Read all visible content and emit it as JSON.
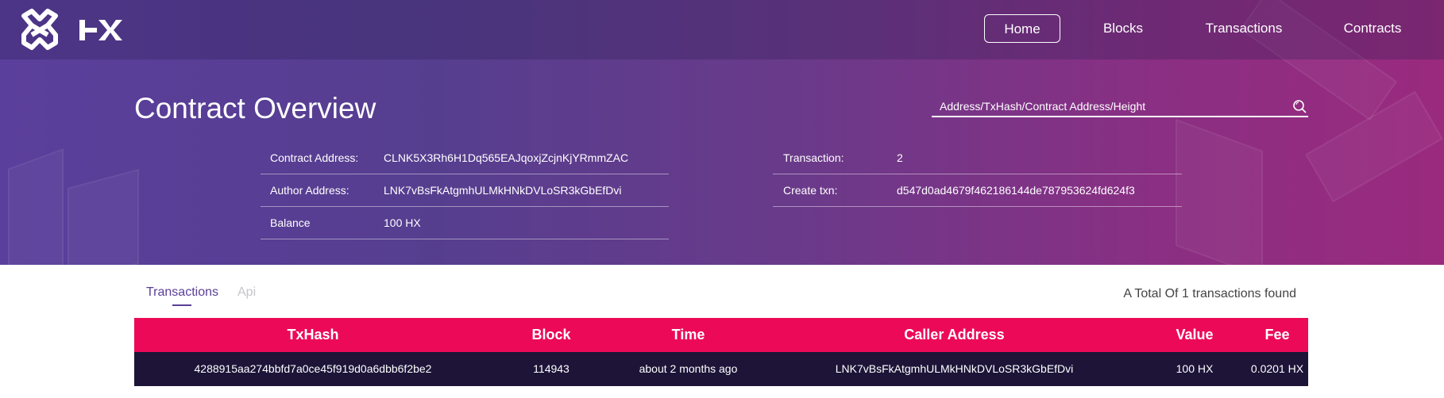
{
  "nav": {
    "logo_text": "HX",
    "items": [
      {
        "label": "Home"
      },
      {
        "label": "Blocks"
      },
      {
        "label": "Transactions"
      },
      {
        "label": "Contracts"
      }
    ]
  },
  "hero": {
    "title": "Contract Overview",
    "search_placeholder": "Address/TxHash/Contract Address/Height"
  },
  "contract_info": {
    "left": [
      {
        "label": "Contract Address:",
        "value": "CLNK5X3Rh6H1Dq565EAJqoxjZcjnKjYRmmZAC"
      },
      {
        "label": "Author Address:",
        "value": "LNK7vBsFkAtgmhULMkHNkDVLoSR3kGbEfDvi"
      },
      {
        "label": "Balance",
        "value": "100 HX"
      }
    ],
    "right": [
      {
        "label": "Transaction:",
        "value": "2"
      },
      {
        "label": "Create txn:",
        "value": "d547d0ad4679f462186144de787953624fd624f3"
      }
    ]
  },
  "tabs": [
    {
      "label": "Transactions",
      "active": true
    },
    {
      "label": "Api",
      "active": false
    }
  ],
  "total_text": "A Total Of 1 transactions found",
  "table": {
    "columns": [
      "TxHash",
      "Block",
      "Time",
      "Caller Address",
      "Value",
      "Fee"
    ],
    "rows": [
      [
        "4288915aa274bbfd7a0ce45f919d0a6dbb6f2be2",
        "114943",
        "about 2 months ago",
        "LNK7vBsFkAtgmhULMkHNkDVLoSR3kGbEfDvi",
        "100 HX",
        "0.0201 HX"
      ]
    ]
  },
  "colors": {
    "header_accent": "#ec0a58",
    "row_bg": "#1d1438",
    "tab_active": "#5a3f96"
  },
  "icons": [
    "hx-logo-icon",
    "search-icon"
  ]
}
